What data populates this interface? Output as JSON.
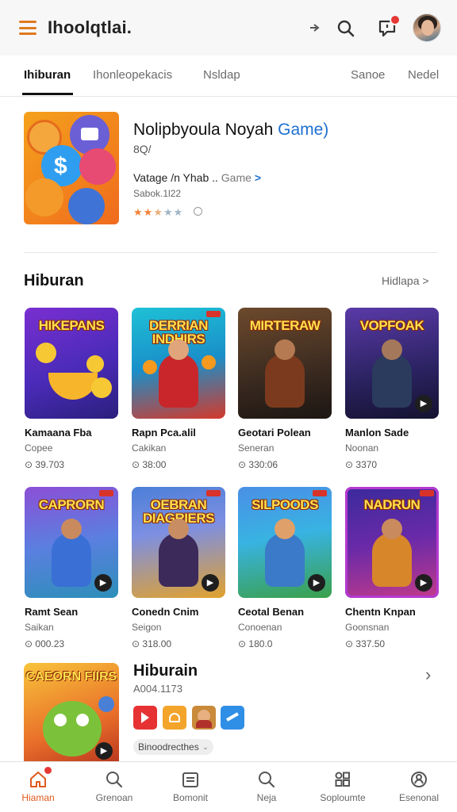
{
  "app": {
    "title": "Ihoolqtlai."
  },
  "header_icons": [
    "menu-icon",
    "cast-icon",
    "search-icon",
    "notification-icon",
    "avatar"
  ],
  "colors": {
    "accent": "#e0791e",
    "link": "#1e6fd1",
    "badge": "#e53935",
    "active_nav": "#e0591e"
  },
  "tabs": [
    {
      "label": "Ihiburan",
      "active": true
    },
    {
      "label": "Ihonleopekacis",
      "active": false
    },
    {
      "label": "Nsldap",
      "active": false
    },
    {
      "label": "Sanoe",
      "active": false
    },
    {
      "label": "Nedel",
      "active": false
    }
  ],
  "featured": {
    "title": "Nolipbyoula Noyah",
    "title_accent": "Game)",
    "subtitle": "8Q/",
    "link_text": "Vatage /n Yhab ..",
    "link_grey": "Game",
    "link_chevron": ">",
    "meta": "Sabok.1l22",
    "stars": "★★★★★",
    "rating": 2.5
  },
  "section": {
    "title": "Hiburan",
    "more": "Hidlapa",
    "more_chevron": ">"
  },
  "cards": [
    {
      "thumb_title": "HIKEPANS",
      "title": "Kamaana Fba",
      "sub": "Copee",
      "count": "⊙ 39.703"
    },
    {
      "thumb_title": "DERRIAN INDHIRS",
      "title": "Rapn Pca.alil",
      "sub": "Cakikan",
      "count": "⊙ 38:00"
    },
    {
      "thumb_title": "MIRTERAW",
      "title": "Geotari Polean",
      "sub": "Seneran",
      "count": "⊙ 330:06"
    },
    {
      "thumb_title": "VOPFOAK",
      "title": "Manlon Sade",
      "sub": "Noonan",
      "count": "⊙ 3370"
    },
    {
      "thumb_title": "CAPRORN",
      "title": "Ramt Sean",
      "sub": "Saikan",
      "count": "⊙ 000.23"
    },
    {
      "thumb_title": "OEBRAN DIAGRIERS",
      "title": "Conedn Cnim",
      "sub": "Seigon",
      "count": "⊙ 318.00"
    },
    {
      "thumb_title": "SILPOODS",
      "title": "Ceotal Benan",
      "sub": "Conoenan",
      "count": "⊙ 180.0"
    },
    {
      "thumb_title": "NADRUN",
      "title": "Chentn Knpan",
      "sub": "Goonsnan",
      "count": "⊙ 337.50"
    }
  ],
  "bottom_feature": {
    "thumb_title": "CAEORN FIIRS",
    "title": "Hiburain",
    "sub": "A004.1173",
    "chip": "Binoodrecthes",
    "chip_dd": "⌄"
  },
  "nav": [
    {
      "label": "Hiaman",
      "icon": "home-icon",
      "active": true
    },
    {
      "label": "Grenoan",
      "icon": "search-icon",
      "active": false
    },
    {
      "label": "Bomonit",
      "icon": "calendar-icon",
      "active": false
    },
    {
      "label": "Neja",
      "icon": "search-icon",
      "active": false
    },
    {
      "label": "Soploumte",
      "icon": "grid-icon",
      "active": false
    },
    {
      "label": "Esenonal",
      "icon": "profile-icon",
      "active": false
    }
  ]
}
